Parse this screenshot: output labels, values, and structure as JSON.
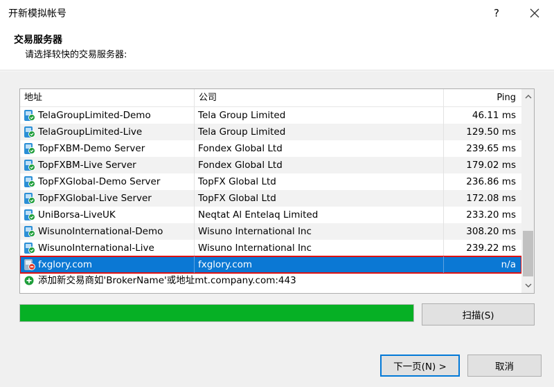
{
  "window": {
    "title": "开新模拟帐号",
    "help": "?"
  },
  "header": {
    "title": "交易服务器",
    "subtitle": "请选择较快的交易服务器:"
  },
  "table": {
    "columns": {
      "address": "地址",
      "company": "公司",
      "ping": "Ping"
    },
    "rows": [
      {
        "address": "TelaGroupLimited-Demo",
        "company": "Tela Group Limited",
        "ping": "46.11 ms",
        "icon": "server-ok-icon"
      },
      {
        "address": "TelaGroupLimited-Live",
        "company": "Tela Group Limited",
        "ping": "129.50 ms",
        "icon": "server-ok-icon"
      },
      {
        "address": "TopFXBM-Demo Server",
        "company": "Fondex Global Ltd",
        "ping": "239.65 ms",
        "icon": "server-ok-icon"
      },
      {
        "address": "TopFXBM-Live Server",
        "company": "Fondex Global Ltd",
        "ping": "179.02 ms",
        "icon": "server-ok-icon"
      },
      {
        "address": "TopFXGlobal-Demo Server",
        "company": "TopFX Global Ltd",
        "ping": "236.86 ms",
        "icon": "server-ok-icon"
      },
      {
        "address": "TopFXGlobal-Live Server",
        "company": "TopFX Global Ltd",
        "ping": "172.08 ms",
        "icon": "server-ok-icon"
      },
      {
        "address": "UniBorsa-LiveUK",
        "company": "Neqtat Al Entelaq Limited",
        "ping": "233.20 ms",
        "icon": "server-ok-icon"
      },
      {
        "address": "WisunoInternational-Demo",
        "company": "Wisuno International Inc",
        "ping": "308.20 ms",
        "icon": "server-ok-icon"
      },
      {
        "address": "WisunoInternational-Live",
        "company": "Wisuno International Inc",
        "ping": "239.22 ms",
        "icon": "server-ok-icon"
      },
      {
        "address": "fxglory.com",
        "company": "fxglory.com",
        "ping": "n/a",
        "icon": "server-error-icon",
        "selected": true
      }
    ],
    "add_row": "添加新交易商如'BrokerName'或地址mt.company.com:443"
  },
  "progress": {
    "value": 1.0,
    "color": "#06b025"
  },
  "buttons": {
    "scan": "扫描(S)",
    "next": "下一页(N) >",
    "cancel": "取消"
  },
  "colors": {
    "selection": "#0b78d4",
    "highlight_border": "#e01010",
    "ok_icon": "#1e9e3a",
    "error_icon": "#e03a2a"
  }
}
